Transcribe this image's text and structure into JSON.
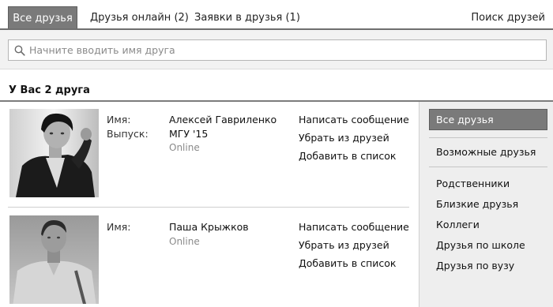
{
  "tabs": {
    "all_friends": "Все друзья",
    "online": "Друзья онлайн (2)",
    "requests": "Заявки в друзья (1)",
    "search_friends": "Поиск друзей"
  },
  "search": {
    "placeholder": "Начните вводить имя друга",
    "value": ""
  },
  "friends_count_title": "У Вас 2 друга",
  "friends": [
    {
      "name_label": "Имя:",
      "name": "Алексей Гавриленко",
      "graduation_label": "Выпуск:",
      "graduation": "МГУ '15",
      "status": "Online",
      "actions": [
        "Написать сообщение",
        "Убрать из друзей",
        "Добавить в список"
      ]
    },
    {
      "name_label": "Имя:",
      "name": "Паша Крыжков",
      "status": "Online",
      "actions": [
        "Написать сообщение",
        "Убрать из друзей",
        "Добавить в список"
      ]
    }
  ],
  "sidebar": {
    "active": "Все друзья",
    "possible": "Возможные друзья",
    "lists": [
      "Родственники",
      "Близкие друзья",
      "Коллеги",
      "Друзья по школе",
      "Друзья по вузу"
    ]
  }
}
